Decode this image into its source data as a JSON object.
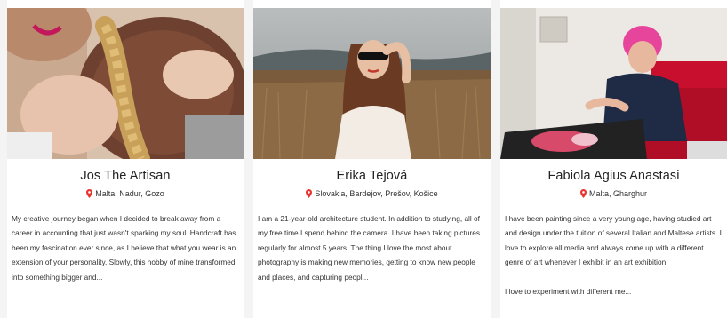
{
  "colors": {
    "pin": "#e8332e",
    "text": "#333333",
    "card": "#ffffff",
    "background": "#f4f4f4"
  },
  "icons": {
    "location": "map-pin-icon"
  },
  "artists": [
    {
      "name": "Jos The Artisan",
      "location": "Malta, Nadur, Gozo",
      "bio": [
        "My creative journey began when I decided to break away from a career in accounting that just wasn't sparking my soul. Handcraft has been my fascination ever since, as I believe that what you wear is an extension of your personality. Slowly, this hobby of mine transformed into something bigger and..."
      ]
    },
    {
      "name": "Erika Tejová",
      "location": "Slovakia, Bardejov, Prešov, Košice",
      "bio": [
        "I am a 21-year-old architecture student. In addition to studying, all of my free time I spend behind the camera. I have been taking pictures regularly for almost 5 years. The thing I love the most about photography is making new memories, getting to know new people and places, and capturing peopl..."
      ]
    },
    {
      "name": "Fabiola Agius Anastasi",
      "location": "Malta, Gharghur",
      "bio": [
        "I have been painting since a very young age, having studied art and design under the tuition of several Italian and Maltese artists. I love to explore all media and always come up with a different genre of art whenever I exhibit in an art exhibition.",
        "I love to experiment with different me..."
      ]
    }
  ]
}
